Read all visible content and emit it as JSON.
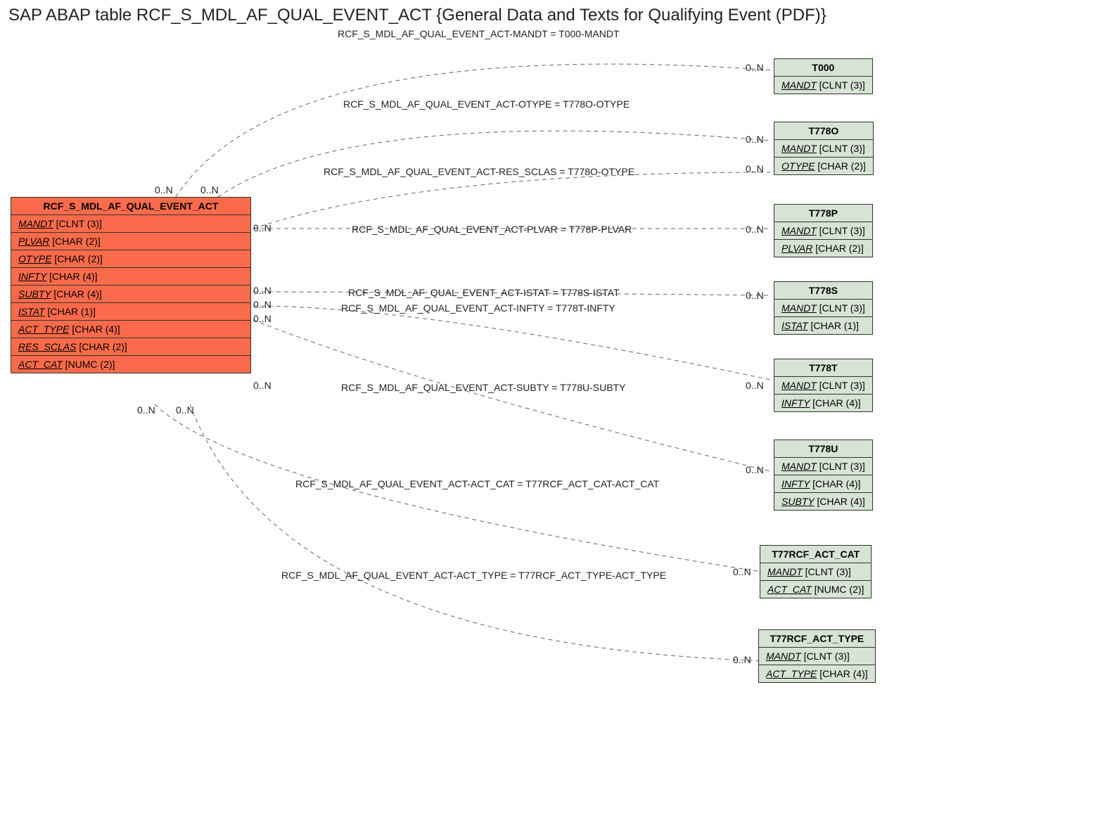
{
  "title": "SAP ABAP table RCF_S_MDL_AF_QUAL_EVENT_ACT {General Data and Texts for Qualifying Event (PDF)}",
  "main_entity": {
    "name": "RCF_S_MDL_AF_QUAL_EVENT_ACT",
    "fields": [
      {
        "name": "MANDT",
        "type": "[CLNT (3)]"
      },
      {
        "name": "PLVAR",
        "type": "[CHAR (2)]"
      },
      {
        "name": "OTYPE",
        "type": "[CHAR (2)]"
      },
      {
        "name": "INFTY",
        "type": "[CHAR (4)]"
      },
      {
        "name": "SUBTY",
        "type": "[CHAR (4)]"
      },
      {
        "name": "ISTAT",
        "type": "[CHAR (1)]"
      },
      {
        "name": "ACT_TYPE",
        "type": "[CHAR (4)]"
      },
      {
        "name": "RES_SCLAS",
        "type": "[CHAR (2)]"
      },
      {
        "name": "ACT_CAT",
        "type": "[NUMC (2)]"
      }
    ]
  },
  "targets": [
    {
      "name": "T000",
      "fields": [
        {
          "name": "MANDT",
          "type": "[CLNT (3)]",
          "key": true
        }
      ]
    },
    {
      "name": "T778O",
      "fields": [
        {
          "name": "MANDT",
          "type": "[CLNT (3)]",
          "key": true
        },
        {
          "name": "OTYPE",
          "type": "[CHAR (2)]",
          "key": true
        }
      ]
    },
    {
      "name": "T778P",
      "fields": [
        {
          "name": "MANDT",
          "type": "[CLNT (3)]",
          "key": true
        },
        {
          "name": "PLVAR",
          "type": "[CHAR (2)]",
          "key": true
        }
      ]
    },
    {
      "name": "T778S",
      "fields": [
        {
          "name": "MANDT",
          "type": "[CLNT (3)]",
          "key": true
        },
        {
          "name": "ISTAT",
          "type": "[CHAR (1)]",
          "key": true
        }
      ]
    },
    {
      "name": "T778T",
      "fields": [
        {
          "name": "MANDT",
          "type": "[CLNT (3)]",
          "key": true
        },
        {
          "name": "INFTY",
          "type": "[CHAR (4)]",
          "key": true
        }
      ]
    },
    {
      "name": "T778U",
      "fields": [
        {
          "name": "MANDT",
          "type": "[CLNT (3)]",
          "key": true
        },
        {
          "name": "INFTY",
          "type": "[CHAR (4)]",
          "key": true
        },
        {
          "name": "SUBTY",
          "type": "[CHAR (4)]",
          "key": true
        }
      ]
    },
    {
      "name": "T77RCF_ACT_CAT",
      "fields": [
        {
          "name": "MANDT",
          "type": "[CLNT (3)]",
          "key": true
        },
        {
          "name": "ACT_CAT",
          "type": "[NUMC (2)]",
          "key": true
        }
      ]
    },
    {
      "name": "T77RCF_ACT_TYPE",
      "fields": [
        {
          "name": "MANDT",
          "type": "[CLNT (3)]",
          "key": true
        },
        {
          "name": "ACT_TYPE",
          "type": "[CHAR (4)]",
          "key": true
        }
      ]
    }
  ],
  "relations": [
    {
      "label": "RCF_S_MDL_AF_QUAL_EVENT_ACT-MANDT = T000-MANDT"
    },
    {
      "label": "RCF_S_MDL_AF_QUAL_EVENT_ACT-OTYPE = T778O-OTYPE"
    },
    {
      "label": "RCF_S_MDL_AF_QUAL_EVENT_ACT-RES_SCLAS = T778O-OTYPE"
    },
    {
      "label": "RCF_S_MDL_AF_QUAL_EVENT_ACT-PLVAR = T778P-PLVAR"
    },
    {
      "label": "RCF_S_MDL_AF_QUAL_EVENT_ACT-ISTAT = T778S-ISTAT"
    },
    {
      "label": "RCF_S_MDL_AF_QUAL_EVENT_ACT-INFTY = T778T-INFTY"
    },
    {
      "label": "RCF_S_MDL_AF_QUAL_EVENT_ACT-SUBTY = T778U-SUBTY"
    },
    {
      "label": "RCF_S_MDL_AF_QUAL_EVENT_ACT-ACT_CAT = T77RCF_ACT_CAT-ACT_CAT"
    },
    {
      "label": "RCF_S_MDL_AF_QUAL_EVENT_ACT-ACT_TYPE = T77RCF_ACT_TYPE-ACT_TYPE"
    }
  ],
  "card": "0..N"
}
